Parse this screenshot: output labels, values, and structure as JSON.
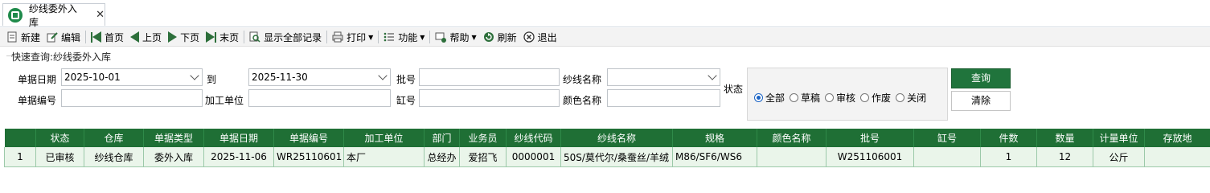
{
  "tab": {
    "title": "纱线委外入库",
    "close": "✕"
  },
  "toolbar": {
    "new": "新建",
    "edit": "编辑",
    "first": "首页",
    "prev": "上页",
    "next": "下页",
    "last": "末页",
    "show_all": "显示全部记录",
    "print": "打印",
    "function": "功能",
    "help": "帮助",
    "refresh": "刷新",
    "exit": "退出"
  },
  "query": {
    "title": "快速查询:纱线委外入库",
    "date_label": "单据日期",
    "date_from": "2025-10-01",
    "to_label": "到",
    "date_to": "2025-11-30",
    "batch_label": "批号",
    "batch_value": "",
    "yarn_name_label": "纱线名称",
    "yarn_name_value": "",
    "status_label": "状态",
    "doc_no_label": "单据编号",
    "doc_no_value": "",
    "unit_label": "加工单位",
    "unit_value": "",
    "vat_label": "缸号",
    "vat_value": "",
    "color_label": "颜色名称",
    "color_value": "",
    "status_options": [
      "全部",
      "草稿",
      "审核",
      "作废",
      "关闭"
    ],
    "status_selected": "全部",
    "query_button": "查询",
    "clear_button": "清除"
  },
  "grid": {
    "columns": [
      "",
      "状态",
      "仓库",
      "单据类型",
      "单据日期",
      "单据编号",
      "加工单位",
      "部门",
      "业务员",
      "纱线代码",
      "纱线名称",
      "规格",
      "颜色名称",
      "批号",
      "缸号",
      "件数",
      "数量",
      "计量单位",
      "存放地"
    ],
    "rows": [
      [
        "1",
        "已审核",
        "纱线仓库",
        "委外入库",
        "2025-11-06",
        "WR25110601",
        "本厂",
        "总经办",
        "爱招飞",
        "0000001",
        "50S/莫代尔/桑蚕丝/羊绒",
        "M86/SF6/WS6",
        "",
        "W251106001",
        "",
        "1",
        "12",
        "公斤",
        ""
      ]
    ]
  },
  "colors": {
    "accent": "#1f6f35",
    "row_bg": "#eaf5ea",
    "radio": "#1a63c4"
  }
}
